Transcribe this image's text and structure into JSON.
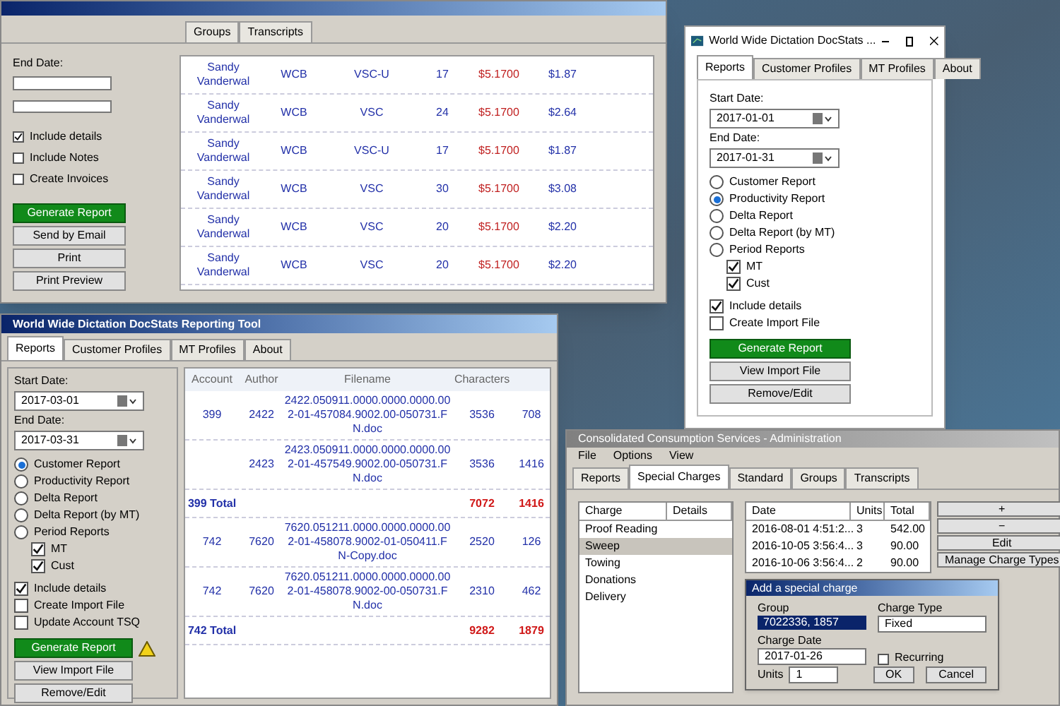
{
  "report_window": {
    "tabs": [
      {
        "label": "Groups",
        "selected": false
      },
      {
        "label": "Transcripts",
        "selected": false
      }
    ],
    "end_date_label": "End Date:",
    "checkboxes": [
      {
        "label": "Include details",
        "checked": true
      },
      {
        "label": "Include Notes",
        "checked": false
      },
      {
        "label": "Create Invoices",
        "checked": false
      }
    ],
    "buttons": [
      {
        "label": "Generate Report",
        "kind": "primary"
      },
      {
        "label": "Send by Email",
        "kind": "normal"
      },
      {
        "label": "Print",
        "kind": "normal"
      },
      {
        "label": "Print Preview",
        "kind": "normal"
      }
    ],
    "rows": [
      {
        "name": "Sandy Vanderwal",
        "code": "WCB",
        "unit": "VSC-U",
        "count": "17",
        "rate": "$5.1700",
        "amount": "$1.87"
      },
      {
        "name": "Sandy Vanderwal",
        "code": "WCB",
        "unit": "VSC",
        "count": "24",
        "rate": "$5.1700",
        "amount": "$2.64"
      },
      {
        "name": "Sandy Vanderwal",
        "code": "WCB",
        "unit": "VSC-U",
        "count": "17",
        "rate": "$5.1700",
        "amount": "$1.87"
      },
      {
        "name": "Sandy Vanderwal",
        "code": "WCB",
        "unit": "VSC",
        "count": "30",
        "rate": "$5.1700",
        "amount": "$3.08"
      },
      {
        "name": "Sandy Vanderwal",
        "code": "WCB",
        "unit": "VSC",
        "count": "20",
        "rate": "$5.1700",
        "amount": "$2.20"
      },
      {
        "name": "Sandy Vanderwal",
        "code": "WCB",
        "unit": "VSC",
        "count": "20",
        "rate": "$5.1700",
        "amount": "$2.20"
      }
    ]
  },
  "docstats_window": {
    "title": "World Wide Dictation DocStats ...",
    "tabs": [
      {
        "label": "Reports",
        "selected": true
      },
      {
        "label": "Customer Profiles",
        "selected": false
      },
      {
        "label": "MT Profiles",
        "selected": false
      },
      {
        "label": "About",
        "selected": false
      }
    ],
    "start_date": {
      "label": "Start Date:",
      "value": "2017-01-01"
    },
    "end_date": {
      "label": "End Date:",
      "value": "2017-01-31"
    },
    "report_types": [
      {
        "label": "Customer Report",
        "selected": false
      },
      {
        "label": "Productivity Report",
        "selected": true
      },
      {
        "label": "Delta Report",
        "selected": false
      },
      {
        "label": "Delta Report (by MT)",
        "selected": false
      },
      {
        "label": "Period Reports",
        "selected": false
      }
    ],
    "period_options": [
      {
        "label": "MT",
        "checked": true
      },
      {
        "label": "Cust",
        "checked": true
      }
    ],
    "options": [
      {
        "label": "Include details",
        "checked": true
      },
      {
        "label": "Create Import File",
        "checked": false
      }
    ],
    "buttons": [
      {
        "label": "Generate Report",
        "kind": "primary"
      },
      {
        "label": "View Import File",
        "kind": "normal"
      },
      {
        "label": "Remove/Edit",
        "kind": "normal"
      }
    ]
  },
  "reporting_tool_window": {
    "title": "World Wide Dictation DocStats Reporting Tool",
    "tabs": [
      {
        "label": "Reports",
        "selected": true
      },
      {
        "label": "Customer Profiles",
        "selected": false
      },
      {
        "label": "MT Profiles",
        "selected": false
      },
      {
        "label": "About",
        "selected": false
      }
    ],
    "start_date": {
      "label": "Start Date:",
      "value": "2017-03-01"
    },
    "end_date": {
      "label": "End Date:",
      "value": "2017-03-31"
    },
    "report_types": [
      {
        "label": "Customer Report",
        "selected": true
      },
      {
        "label": "Productivity Report",
        "selected": false
      },
      {
        "label": "Delta Report",
        "selected": false
      },
      {
        "label": "Delta Report (by MT)",
        "selected": false
      },
      {
        "label": "Period Reports",
        "selected": false
      }
    ],
    "period_options": [
      {
        "label": "MT",
        "checked": true
      },
      {
        "label": "Cust",
        "checked": true
      }
    ],
    "options": [
      {
        "label": "Include details",
        "checked": true
      },
      {
        "label": "Create Import File",
        "checked": false
      },
      {
        "label": "Update Account TSQ",
        "checked": false
      }
    ],
    "buttons": [
      {
        "label": "Generate Report",
        "kind": "primary"
      },
      {
        "label": "View Import File",
        "kind": "normal"
      },
      {
        "label": "Remove/Edit",
        "kind": "normal"
      }
    ],
    "columns": [
      "Account",
      "Author",
      "Filename",
      "Characters"
    ],
    "rows": [
      {
        "account": "399",
        "author": "2422",
        "filename": "2422.050911.0000.0000.0000.002-01-457084.9002.00-050731.FN.doc",
        "characters": "3536",
        "column_5": "708",
        "total": false
      },
      {
        "account": "",
        "author": "2423",
        "filename": "2423.050911.0000.0000.0000.002-01-457549.9002.00-050731.FN.doc",
        "characters": "3536",
        "column_5": "1416",
        "total": false
      },
      {
        "account": "399 Total",
        "author": "",
        "filename": "",
        "characters": "7072",
        "column_5": "1416",
        "total": true
      },
      {
        "account": "742",
        "author": "7620",
        "filename": "7620.051211.0000.0000.0000.002-01-458078.9002-01-050411.FN-Copy.doc",
        "characters": "2520",
        "column_5": "126",
        "total": false
      },
      {
        "account": "742",
        "author": "7620",
        "filename": "7620.051211.0000.0000.0000.002-01-458078.9002-00-050731.FN.doc",
        "characters": "2310",
        "column_5": "462",
        "total": false
      },
      {
        "account": "742 Total",
        "author": "",
        "filename": "",
        "characters": "9282",
        "column_5": "1879",
        "total": true
      }
    ]
  },
  "admin_window": {
    "title": "Consolidated Consumption Services - Administration",
    "menu": [
      "File",
      "Options",
      "View"
    ],
    "tabs": [
      {
        "label": "Reports",
        "selected": false
      },
      {
        "label": "Special Charges",
        "selected": true
      },
      {
        "label": "Standard",
        "selected": false
      },
      {
        "label": "Groups",
        "selected": false
      },
      {
        "label": "Transcripts",
        "selected": false
      }
    ],
    "charge_columns": [
      "Charge",
      "Details"
    ],
    "charges": [
      {
        "label": "Proof Reading",
        "selected": false
      },
      {
        "label": "Sweep",
        "selected": true
      },
      {
        "label": "Towing",
        "selected": false
      },
      {
        "label": "Donations",
        "selected": false
      },
      {
        "label": "Delivery",
        "selected": false
      }
    ],
    "history_columns": [
      "Date",
      "Units",
      "Total"
    ],
    "history": [
      {
        "date": "2016-08-01 4:51:2...",
        "units": "3",
        "total": "542.00"
      },
      {
        "date": "2016-10-05 3:56:4...",
        "units": "3",
        "total": "90.00"
      },
      {
        "date": "2016-10-06 3:56:4...",
        "units": "2",
        "total": "90.00"
      }
    ],
    "side_buttons": [
      "+",
      "−",
      "Edit",
      "Manage Charge Types"
    ],
    "dialog": {
      "title": "Add a special charge",
      "group_label": "Group",
      "group_value": "7022336, 1857",
      "type_label": "Charge Type",
      "type_value": "Fixed",
      "date_label": "Charge Date",
      "date_value": "2017-01-26",
      "recurring": {
        "label": "Recurring",
        "checked": false
      },
      "units_label": "Units",
      "units_value": "1",
      "buttons": [
        "OK",
        "Cancel"
      ]
    }
  }
}
